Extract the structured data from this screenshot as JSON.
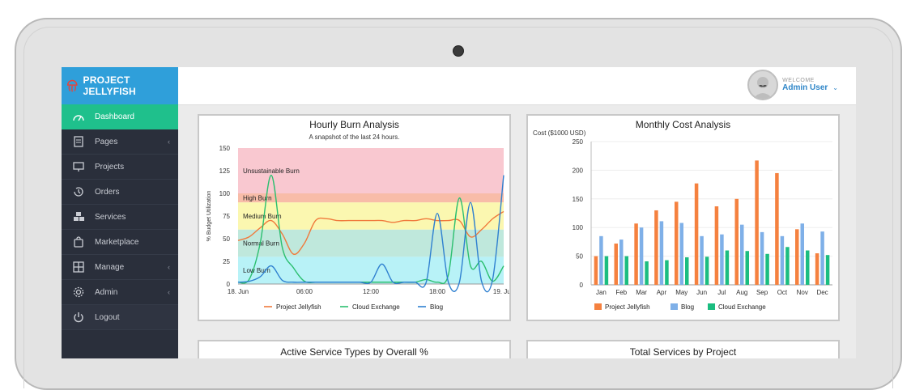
{
  "app": {
    "name": "PROJECT JELLYFISH"
  },
  "sidebar": {
    "items": [
      {
        "label": "Dashboard",
        "icon": "speedometer-icon",
        "active": true
      },
      {
        "label": "Pages",
        "icon": "document-icon",
        "caret": true
      },
      {
        "label": "Projects",
        "icon": "presentation-icon"
      },
      {
        "label": "Orders",
        "icon": "history-icon"
      },
      {
        "label": "Services",
        "icon": "boxes-icon"
      },
      {
        "label": "Marketplace",
        "icon": "shopping-bag-icon"
      },
      {
        "label": "Manage",
        "icon": "layout-icon",
        "caret": true
      },
      {
        "label": "Admin",
        "icon": "gear-icon",
        "caret": true
      },
      {
        "label": "Logout",
        "icon": "power-icon"
      }
    ]
  },
  "header": {
    "welcome": "WELCOME",
    "user": "Admin User"
  },
  "panels": {
    "burn_title": "Hourly Burn Analysis",
    "burn_subtitle": "A snapshot of the last 24 hours.",
    "cost_title": "Monthly Cost Analysis",
    "active_title": "Active Service Types by Overall %",
    "total_title": "Total Services by Project"
  },
  "colors": {
    "project_jellyfish": "#f07a3c",
    "cloud_exchange": "#2bbf6f",
    "blog": "#2f80d0",
    "bar_project": "#f5813f",
    "bar_blog": "#7fb0e8",
    "bar_cloud": "#1bbd80",
    "band_unsustainable": "#f9c8d0",
    "band_high": "#f8bca8",
    "band_medium": "#fbf7b0",
    "band_normal": "#bfe8dc",
    "band_low": "#b8f2f7"
  },
  "chart_data": [
    {
      "type": "line",
      "title": "Hourly Burn Analysis",
      "subtitle": "A snapshot of the last 24 hours.",
      "ylabel": "% Budget Utilization",
      "ylim": [
        0,
        150
      ],
      "yticks": [
        "0",
        "25",
        "50",
        "75",
        "100",
        "125",
        "150"
      ],
      "xticks": [
        "18. Jun",
        "06:00",
        "12:00",
        "18:00",
        "19. Jun"
      ],
      "x": [
        0,
        1,
        2,
        3,
        4,
        5,
        6,
        7,
        8,
        9,
        10,
        11,
        12,
        13,
        14,
        15,
        16,
        17,
        18,
        19,
        20,
        21,
        22,
        23,
        24
      ],
      "bands": [
        {
          "label": "Unsustainable Burn",
          "from": 100,
          "to": 150
        },
        {
          "label": "High Burn",
          "from": 90,
          "to": 100
        },
        {
          "label": "Medium Burn",
          "from": 60,
          "to": 90
        },
        {
          "label": "Normal Burn",
          "from": 30,
          "to": 60
        },
        {
          "label": "Low Burn",
          "from": 0,
          "to": 30
        }
      ],
      "series": [
        {
          "name": "Project Jellyfish",
          "values": [
            48,
            52,
            62,
            70,
            55,
            33,
            45,
            70,
            72,
            70,
            70,
            70,
            70,
            70,
            68,
            70,
            70,
            72,
            70,
            70,
            70,
            52,
            60,
            72,
            80
          ]
        },
        {
          "name": "Cloud Exchange",
          "values": [
            2,
            5,
            45,
            120,
            40,
            18,
            3,
            2,
            2,
            2,
            2,
            2,
            2,
            2,
            2,
            2,
            2,
            5,
            2,
            10,
            95,
            20,
            25,
            3,
            20
          ]
        },
        {
          "name": "Blog",
          "values": [
            2,
            3,
            8,
            20,
            4,
            2,
            2,
            2,
            2,
            2,
            2,
            2,
            2,
            22,
            2,
            2,
            2,
            2,
            78,
            2,
            2,
            90,
            3,
            5,
            120
          ]
        }
      ],
      "legend": "bottom"
    },
    {
      "type": "bar",
      "title": "Monthly Cost Analysis",
      "ylabel": "Cost ($1000 USD)",
      "ylim": [
        0,
        250
      ],
      "yticks": [
        "0",
        "50",
        "100",
        "150",
        "200",
        "250"
      ],
      "categories": [
        "Jan",
        "Feb",
        "Mar",
        "Apr",
        "May",
        "Jun",
        "Jul",
        "Aug",
        "Sep",
        "Oct",
        "Nov",
        "Dec"
      ],
      "series": [
        {
          "name": "Project Jellyfish",
          "values": [
            50,
            72,
            107,
            130,
            145,
            177,
            137,
            150,
            217,
            195,
            97,
            55
          ]
        },
        {
          "name": "Blog",
          "values": [
            85,
            79,
            100,
            111,
            108,
            85,
            88,
            105,
            92,
            85,
            107,
            93
          ]
        },
        {
          "name": "Cloud Exchange",
          "values": [
            50,
            50,
            41,
            43,
            48,
            49,
            60,
            59,
            54,
            66,
            60,
            52
          ]
        }
      ],
      "legend": "bottom"
    }
  ]
}
